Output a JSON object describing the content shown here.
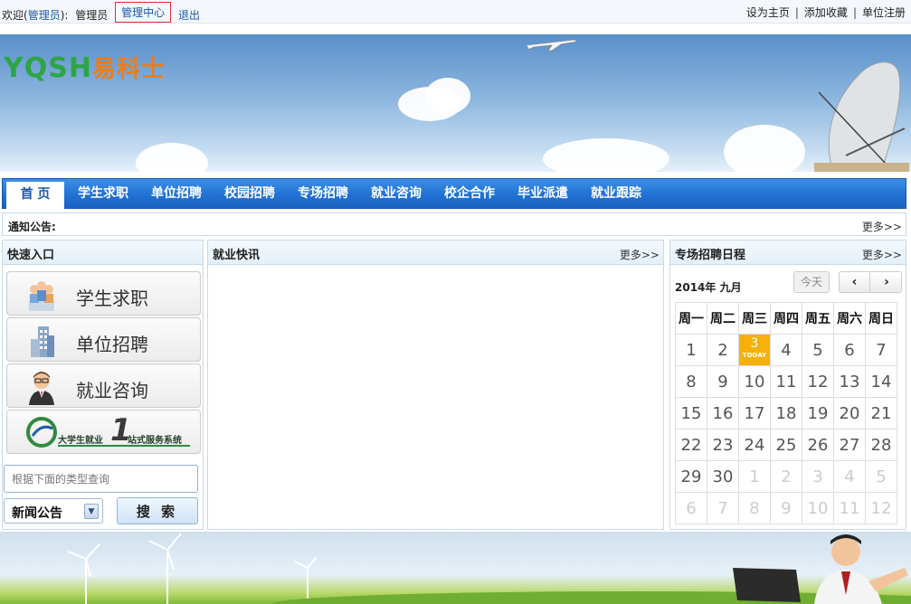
{
  "topbar": {
    "welcome_prefix": "欢迎(",
    "role_link": "管理员",
    "welcome_suffix": "):",
    "username": "管理员",
    "admin_center": "管理中心",
    "logout": "退出",
    "set_home": "设为主页",
    "add_favorite": "添加收藏",
    "company_register": "单位注册",
    "sep": "|"
  },
  "banner": {
    "logo_en": "YQSH",
    "logo_cn": "易科士"
  },
  "nav": {
    "items": [
      "首 页",
      "学生求职",
      "单位招聘",
      "校园招聘",
      "专场招聘",
      "就业咨询",
      "校企合作",
      "毕业派遣",
      "就业跟踪"
    ]
  },
  "notice": {
    "title": "通知公告:",
    "more": "更多>>"
  },
  "quick_entry": {
    "title": "快速入口",
    "buttons": [
      "学生求职",
      "单位招聘",
      "就业咨询"
    ],
    "banner_left": "大学生就业",
    "banner_num": "1",
    "banner_right": "站式服务系统"
  },
  "search": {
    "placeholder": "根据下面的类型查询",
    "select_value": "新闻公告",
    "button": "搜 索"
  },
  "news": {
    "title": "就业快讯",
    "more": "更多>>"
  },
  "schedule": {
    "title": "专场招聘日程",
    "more": "更多>>",
    "month_label": "2014年 九月",
    "today_label": "今天",
    "prev": "‹",
    "next": "›",
    "today_badge": "TODAY",
    "weekdays": [
      "周一",
      "周二",
      "周三",
      "周四",
      "周五",
      "周六",
      "周日"
    ],
    "weeks": [
      [
        {
          "d": "1"
        },
        {
          "d": "2"
        },
        {
          "d": "3",
          "today": true
        },
        {
          "d": "4"
        },
        {
          "d": "5"
        },
        {
          "d": "6"
        },
        {
          "d": "7"
        }
      ],
      [
        {
          "d": "8"
        },
        {
          "d": "9"
        },
        {
          "d": "10"
        },
        {
          "d": "11"
        },
        {
          "d": "12"
        },
        {
          "d": "13"
        },
        {
          "d": "14"
        }
      ],
      [
        {
          "d": "15"
        },
        {
          "d": "16"
        },
        {
          "d": "17"
        },
        {
          "d": "18"
        },
        {
          "d": "19"
        },
        {
          "d": "20"
        },
        {
          "d": "21"
        }
      ],
      [
        {
          "d": "22"
        },
        {
          "d": "23"
        },
        {
          "d": "24"
        },
        {
          "d": "25"
        },
        {
          "d": "26"
        },
        {
          "d": "27"
        },
        {
          "d": "28"
        }
      ],
      [
        {
          "d": "29"
        },
        {
          "d": "30"
        },
        {
          "d": "1",
          "other": true
        },
        {
          "d": "2",
          "other": true
        },
        {
          "d": "3",
          "other": true
        },
        {
          "d": "4",
          "other": true
        },
        {
          "d": "5",
          "other": true
        }
      ],
      [
        {
          "d": "6",
          "other": true
        },
        {
          "d": "7",
          "other": true
        },
        {
          "d": "8",
          "other": true
        },
        {
          "d": "9",
          "other": true
        },
        {
          "d": "10",
          "other": true
        },
        {
          "d": "11",
          "other": true
        },
        {
          "d": "12",
          "other": true
        }
      ]
    ]
  },
  "colors": {
    "nav_blue": "#1f6fd2",
    "link_blue": "#1a57a5",
    "today_orange": "#f7b00a",
    "logo_green": "#2da544",
    "logo_orange": "#f07c14"
  }
}
